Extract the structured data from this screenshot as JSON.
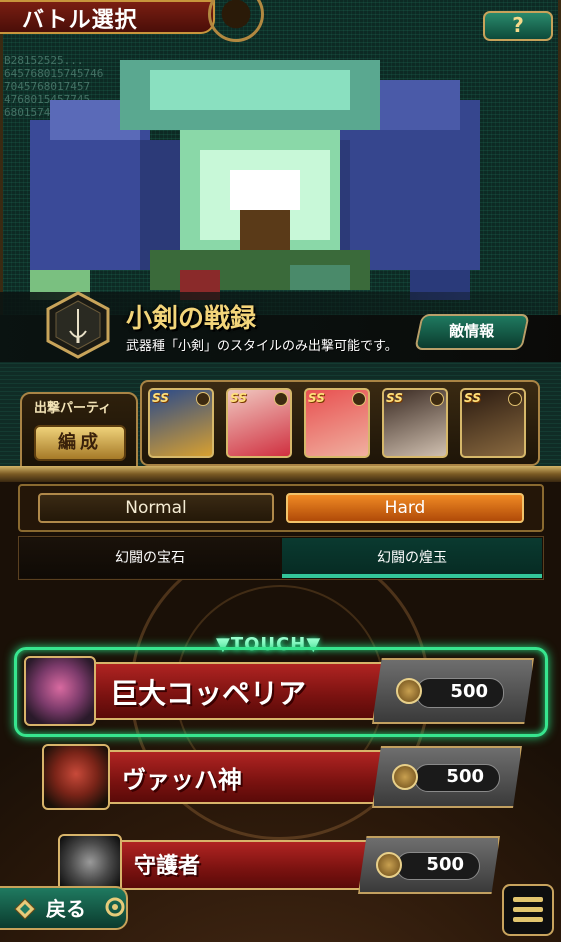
{
  "header": {
    "title": "バトル選択",
    "help_label": "?"
  },
  "glitch_text": [
    "B28152525...",
    "645768015745746",
    "7045768017457",
    "4768015457745",
    "6801574574577"
  ],
  "boss": {
    "name": "小剣の戦録",
    "description": "武器種「小剣」のスタイルのみ出撃可能です。",
    "enemy_info_label": "敵情報"
  },
  "party": {
    "label": "出撃パーティ",
    "edit_label": "編成",
    "members": [
      {
        "rank": "SS",
        "colors": [
          "#2a4a8a",
          "#d8a030"
        ]
      },
      {
        "rank": "SS",
        "colors": [
          "#f0c8c0",
          "#d03040"
        ]
      },
      {
        "rank": "SS",
        "colors": [
          "#e85050",
          "#f0b0a0"
        ]
      },
      {
        "rank": "SS",
        "colors": [
          "#3a2a22",
          "#d0c0b0"
        ]
      },
      {
        "rank": "SS",
        "colors": [
          "#2a1a10",
          "#8a6a40"
        ]
      }
    ]
  },
  "difficulty": {
    "tabs": [
      "Normal",
      "Hard"
    ],
    "selected": "Hard"
  },
  "subtabs": {
    "tabs": [
      "幻闘の宝石",
      "幻闘の煌玉"
    ],
    "selected": "幻闘の煌玉"
  },
  "touch_label": "▼TOUCH▼",
  "bosses": [
    {
      "name": "巨大コッペリア",
      "cost": "500"
    },
    {
      "name": "ヴァッハ神",
      "cost": "500"
    },
    {
      "name": "守護者",
      "cost": "500"
    }
  ],
  "back_label": "戻る",
  "colors": {
    "accent_green": "#37e58e",
    "gold": "#d8b46a",
    "red": "#b02422",
    "hard_orange": "#f08a24"
  }
}
